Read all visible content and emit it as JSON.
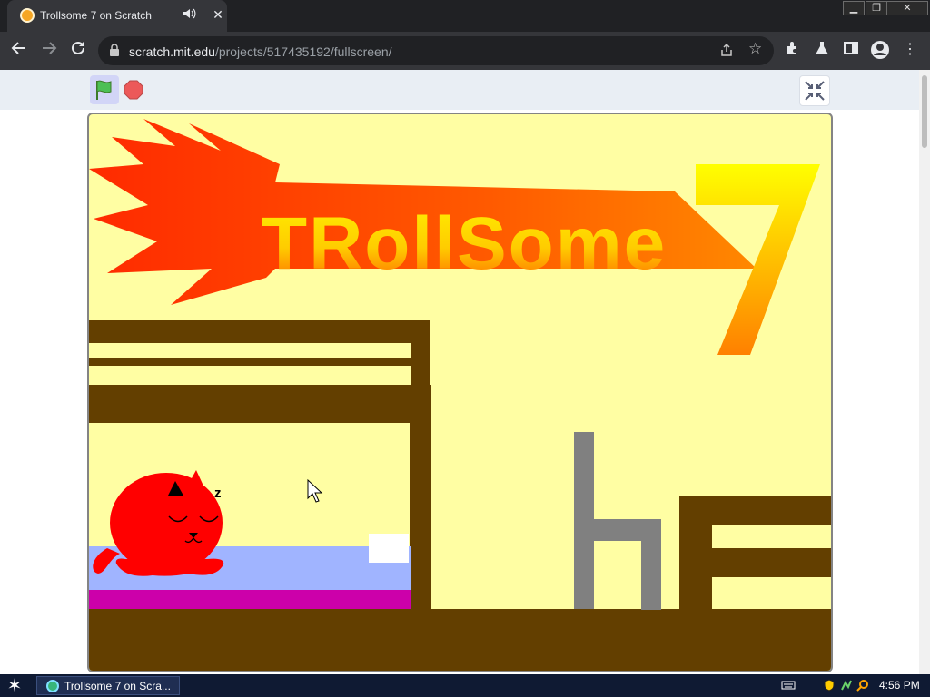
{
  "browser": {
    "tab_title": "Trollsome 7 on Scratch",
    "url_host": "scratch.mit.edu",
    "url_path": "/projects/517435192/fullscreen/",
    "window_buttons": [
      "minimize",
      "restore",
      "close"
    ],
    "nav_icons": [
      "back-icon",
      "forward-icon",
      "reload-icon"
    ],
    "toolbar_icons": [
      "extensions-icon",
      "lab-flask-icon",
      "side-panel-icon",
      "profile-icon",
      "menu-icon"
    ]
  },
  "player": {
    "controls": [
      "green-flag-icon",
      "stop-sign-icon",
      "exit-fullscreen-icon"
    ],
    "stage": {
      "title_text": "TRollSome",
      "title_number": "7",
      "sleep_text": "z",
      "colors": {
        "background": "#fffea3",
        "wood": "#633f00",
        "cat": "#ff0000",
        "mattress": "#a0b4ff",
        "bed_base": "#cc00aa",
        "chair": "#808080"
      }
    }
  },
  "taskbar": {
    "task_label": "Trollsome 7 on Scra...",
    "clock": "4:56 PM"
  }
}
